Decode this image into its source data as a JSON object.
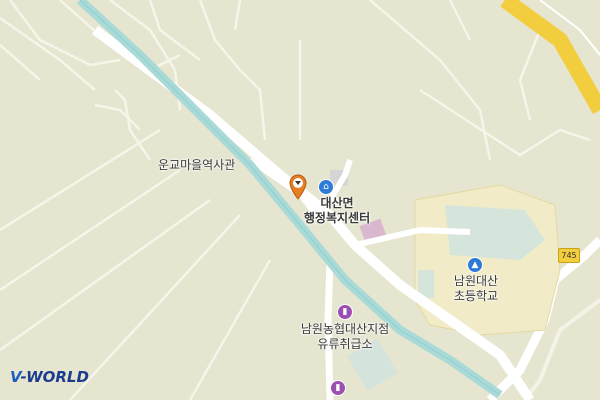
{
  "map": {
    "labels": {
      "history_hall": "운교마을역사관",
      "admin_center_line1": "대산면",
      "admin_center_line2": "행정복지센터",
      "school_line1": "남원대산",
      "school_line2": "초등학교",
      "gas_station_line1": "남원농협대산지점",
      "gas_station_line2": "유류취급소"
    },
    "route_shield": "745",
    "logo": {
      "part1": "V",
      "part2": "-WORLD"
    },
    "icons": [
      "location-pin-icon",
      "home-icon",
      "school-icon",
      "gas-station-icon"
    ],
    "colors": {
      "land": "#e6e5cf",
      "river": "#a9dad8",
      "road": "#ffffff",
      "highway": "#f2cd3d",
      "poi_blue": "#2d7bd6",
      "poi_purple": "#9b4fb0",
      "pin": "#e67e22"
    }
  }
}
